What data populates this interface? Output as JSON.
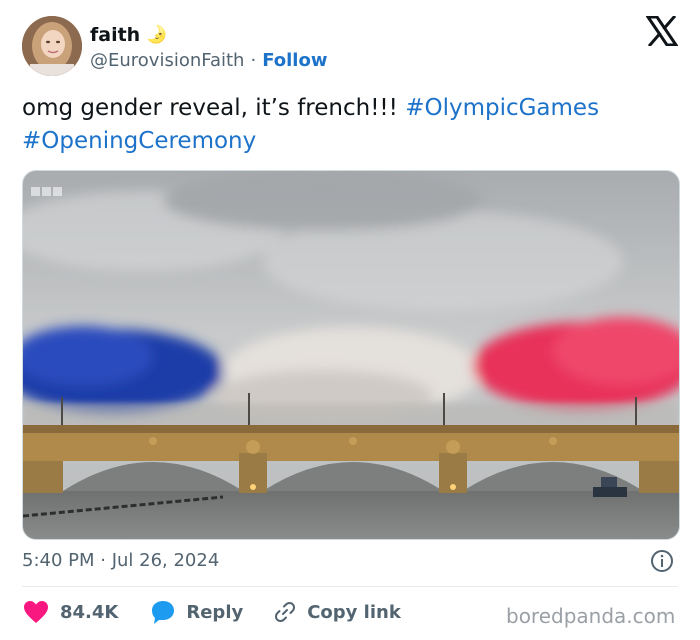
{
  "author": {
    "name": "faith",
    "handle": "@EurovisionFaith",
    "follow_label": "Follow",
    "name_emoji": "🌛"
  },
  "tweet": {
    "text_plain": "omg gender reveal, it’s french!!!",
    "hashtags": [
      "#OlympicGames",
      "#OpeningCeremony"
    ],
    "timestamp": "5:40 PM · Jul 26, 2024"
  },
  "media": {
    "description_colors": {
      "blue": "#1f3ea8",
      "white": "#e9e6e3",
      "red": "#e8325a"
    }
  },
  "engagement": {
    "likes": "84.4K",
    "reply_label": "Reply",
    "copy_link_label": "Copy link"
  },
  "colors": {
    "link": "#1d72c9",
    "like_heart": "#f91880",
    "reply_bubble": "#1d9bf0",
    "muted": "#536471"
  },
  "icons": [
    "x-logo-icon",
    "moon-emoji-icon",
    "info-icon",
    "heart-icon",
    "reply-bubble-icon",
    "link-icon"
  ],
  "watermark": "boredpanda.com"
}
